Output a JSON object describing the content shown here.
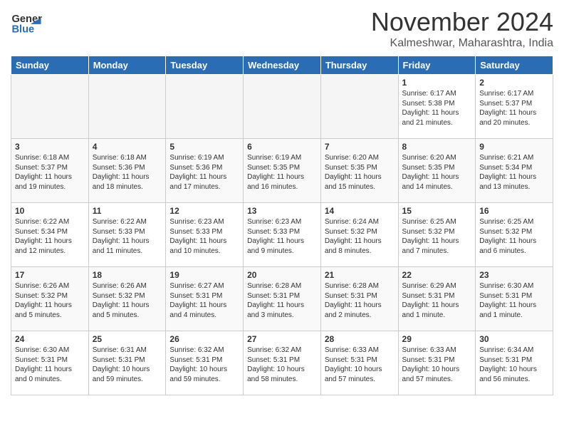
{
  "header": {
    "logo_line1": "General",
    "logo_line2": "Blue",
    "month_title": "November 2024",
    "location": "Kalmeshwar, Maharashtra, India"
  },
  "weekdays": [
    "Sunday",
    "Monday",
    "Tuesday",
    "Wednesday",
    "Thursday",
    "Friday",
    "Saturday"
  ],
  "weeks": [
    [
      {
        "day": "",
        "sunrise": "",
        "sunset": "",
        "daylight": "",
        "empty": true
      },
      {
        "day": "",
        "sunrise": "",
        "sunset": "",
        "daylight": "",
        "empty": true
      },
      {
        "day": "",
        "sunrise": "",
        "sunset": "",
        "daylight": "",
        "empty": true
      },
      {
        "day": "",
        "sunrise": "",
        "sunset": "",
        "daylight": "",
        "empty": true
      },
      {
        "day": "",
        "sunrise": "",
        "sunset": "",
        "daylight": "",
        "empty": true
      },
      {
        "day": "1",
        "sunrise": "Sunrise: 6:17 AM",
        "sunset": "Sunset: 5:38 PM",
        "daylight": "Daylight: 11 hours and 21 minutes.",
        "empty": false
      },
      {
        "day": "2",
        "sunrise": "Sunrise: 6:17 AM",
        "sunset": "Sunset: 5:37 PM",
        "daylight": "Daylight: 11 hours and 20 minutes.",
        "empty": false
      }
    ],
    [
      {
        "day": "3",
        "sunrise": "Sunrise: 6:18 AM",
        "sunset": "Sunset: 5:37 PM",
        "daylight": "Daylight: 11 hours and 19 minutes.",
        "empty": false
      },
      {
        "day": "4",
        "sunrise": "Sunrise: 6:18 AM",
        "sunset": "Sunset: 5:36 PM",
        "daylight": "Daylight: 11 hours and 18 minutes.",
        "empty": false
      },
      {
        "day": "5",
        "sunrise": "Sunrise: 6:19 AM",
        "sunset": "Sunset: 5:36 PM",
        "daylight": "Daylight: 11 hours and 17 minutes.",
        "empty": false
      },
      {
        "day": "6",
        "sunrise": "Sunrise: 6:19 AM",
        "sunset": "Sunset: 5:35 PM",
        "daylight": "Daylight: 11 hours and 16 minutes.",
        "empty": false
      },
      {
        "day": "7",
        "sunrise": "Sunrise: 6:20 AM",
        "sunset": "Sunset: 5:35 PM",
        "daylight": "Daylight: 11 hours and 15 minutes.",
        "empty": false
      },
      {
        "day": "8",
        "sunrise": "Sunrise: 6:20 AM",
        "sunset": "Sunset: 5:35 PM",
        "daylight": "Daylight: 11 hours and 14 minutes.",
        "empty": false
      },
      {
        "day": "9",
        "sunrise": "Sunrise: 6:21 AM",
        "sunset": "Sunset: 5:34 PM",
        "daylight": "Daylight: 11 hours and 13 minutes.",
        "empty": false
      }
    ],
    [
      {
        "day": "10",
        "sunrise": "Sunrise: 6:22 AM",
        "sunset": "Sunset: 5:34 PM",
        "daylight": "Daylight: 11 hours and 12 minutes.",
        "empty": false
      },
      {
        "day": "11",
        "sunrise": "Sunrise: 6:22 AM",
        "sunset": "Sunset: 5:33 PM",
        "daylight": "Daylight: 11 hours and 11 minutes.",
        "empty": false
      },
      {
        "day": "12",
        "sunrise": "Sunrise: 6:23 AM",
        "sunset": "Sunset: 5:33 PM",
        "daylight": "Daylight: 11 hours and 10 minutes.",
        "empty": false
      },
      {
        "day": "13",
        "sunrise": "Sunrise: 6:23 AM",
        "sunset": "Sunset: 5:33 PM",
        "daylight": "Daylight: 11 hours and 9 minutes.",
        "empty": false
      },
      {
        "day": "14",
        "sunrise": "Sunrise: 6:24 AM",
        "sunset": "Sunset: 5:32 PM",
        "daylight": "Daylight: 11 hours and 8 minutes.",
        "empty": false
      },
      {
        "day": "15",
        "sunrise": "Sunrise: 6:25 AM",
        "sunset": "Sunset: 5:32 PM",
        "daylight": "Daylight: 11 hours and 7 minutes.",
        "empty": false
      },
      {
        "day": "16",
        "sunrise": "Sunrise: 6:25 AM",
        "sunset": "Sunset: 5:32 PM",
        "daylight": "Daylight: 11 hours and 6 minutes.",
        "empty": false
      }
    ],
    [
      {
        "day": "17",
        "sunrise": "Sunrise: 6:26 AM",
        "sunset": "Sunset: 5:32 PM",
        "daylight": "Daylight: 11 hours and 5 minutes.",
        "empty": false
      },
      {
        "day": "18",
        "sunrise": "Sunrise: 6:26 AM",
        "sunset": "Sunset: 5:32 PM",
        "daylight": "Daylight: 11 hours and 5 minutes.",
        "empty": false
      },
      {
        "day": "19",
        "sunrise": "Sunrise: 6:27 AM",
        "sunset": "Sunset: 5:31 PM",
        "daylight": "Daylight: 11 hours and 4 minutes.",
        "empty": false
      },
      {
        "day": "20",
        "sunrise": "Sunrise: 6:28 AM",
        "sunset": "Sunset: 5:31 PM",
        "daylight": "Daylight: 11 hours and 3 minutes.",
        "empty": false
      },
      {
        "day": "21",
        "sunrise": "Sunrise: 6:28 AM",
        "sunset": "Sunset: 5:31 PM",
        "daylight": "Daylight: 11 hours and 2 minutes.",
        "empty": false
      },
      {
        "day": "22",
        "sunrise": "Sunrise: 6:29 AM",
        "sunset": "Sunset: 5:31 PM",
        "daylight": "Daylight: 11 hours and 1 minute.",
        "empty": false
      },
      {
        "day": "23",
        "sunrise": "Sunrise: 6:30 AM",
        "sunset": "Sunset: 5:31 PM",
        "daylight": "Daylight: 11 hours and 1 minute.",
        "empty": false
      }
    ],
    [
      {
        "day": "24",
        "sunrise": "Sunrise: 6:30 AM",
        "sunset": "Sunset: 5:31 PM",
        "daylight": "Daylight: 11 hours and 0 minutes.",
        "empty": false
      },
      {
        "day": "25",
        "sunrise": "Sunrise: 6:31 AM",
        "sunset": "Sunset: 5:31 PM",
        "daylight": "Daylight: 10 hours and 59 minutes.",
        "empty": false
      },
      {
        "day": "26",
        "sunrise": "Sunrise: 6:32 AM",
        "sunset": "Sunset: 5:31 PM",
        "daylight": "Daylight: 10 hours and 59 minutes.",
        "empty": false
      },
      {
        "day": "27",
        "sunrise": "Sunrise: 6:32 AM",
        "sunset": "Sunset: 5:31 PM",
        "daylight": "Daylight: 10 hours and 58 minutes.",
        "empty": false
      },
      {
        "day": "28",
        "sunrise": "Sunrise: 6:33 AM",
        "sunset": "Sunset: 5:31 PM",
        "daylight": "Daylight: 10 hours and 57 minutes.",
        "empty": false
      },
      {
        "day": "29",
        "sunrise": "Sunrise: 6:33 AM",
        "sunset": "Sunset: 5:31 PM",
        "daylight": "Daylight: 10 hours and 57 minutes.",
        "empty": false
      },
      {
        "day": "30",
        "sunrise": "Sunrise: 6:34 AM",
        "sunset": "Sunset: 5:31 PM",
        "daylight": "Daylight: 10 hours and 56 minutes.",
        "empty": false
      }
    ]
  ]
}
